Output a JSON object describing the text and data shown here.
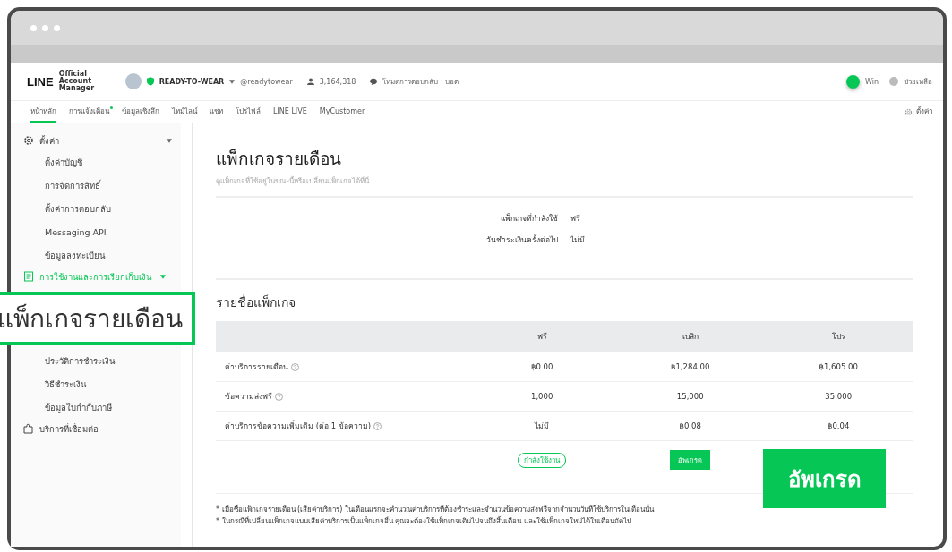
{
  "header": {
    "logo": "LINE",
    "logo_sub": "Official Account Manager",
    "account_name": "READY-TO-WEAR",
    "account_id": "@readytowear",
    "friends": "3,164,318",
    "reply_mode": "โหมดการตอบกลับ : บอต",
    "user": "Win",
    "help": "ช่วยเหลือ"
  },
  "nav": {
    "items": [
      {
        "label": "หน้าหลัก",
        "selected": true,
        "badge": false
      },
      {
        "label": "การแจ้งเตือน",
        "selected": false,
        "badge": true
      },
      {
        "label": "ข้อมูลเชิงลึก",
        "selected": false,
        "badge": false
      },
      {
        "label": "ไทม์ไลน์",
        "selected": false,
        "badge": false
      },
      {
        "label": "แชท",
        "selected": false,
        "badge": false
      },
      {
        "label": "โปรไฟล์",
        "selected": false,
        "badge": false
      },
      {
        "label": "LINE LIVE",
        "selected": false,
        "badge": false
      },
      {
        "label": "MyCustomer",
        "selected": false,
        "badge": false
      }
    ],
    "settings": "ตั้งค่า"
  },
  "sidebar": {
    "items": [
      {
        "label": "ตั้งค่า",
        "kind": "gear",
        "selected": false,
        "expanded": true,
        "children": [
          {
            "label": "ตั้งค่าบัญชี"
          },
          {
            "label": "การจัดการสิทธิ์"
          },
          {
            "label": "ตั้งค่าการตอบกลับ"
          },
          {
            "label": "Messaging API"
          },
          {
            "label": "ข้อมูลลงทะเบียน"
          }
        ]
      },
      {
        "label": "การใช้งานและการเรียกเก็บเงิน",
        "kind": "receipt",
        "selected": true,
        "expanded": true,
        "children": [
          {
            "label": "แพ็กเกจรายเดือน",
            "kind": "callout"
          },
          {
            "label": "ประวัติการชำระเงิน"
          },
          {
            "label": "วิธีชำระเงิน"
          },
          {
            "label": "ข้อมูลใบกำกับภาษี"
          }
        ]
      },
      {
        "label": "บริการที่เชื่อมต่อ",
        "kind": "puzzle",
        "selected": false
      }
    ]
  },
  "page": {
    "title": "แพ็กเกจรายเดือน",
    "subtitle": "ดูแพ็กเกจที่ใช้อยู่ในขณะนี้หรือเปลี่ยนแพ็กเกจได้ที่นี่",
    "info": [
      {
        "label": "แพ็กเกจที่กำลังใช้",
        "value": "ฟรี"
      },
      {
        "label": "วันชำระเงินครั้งต่อไป",
        "value": "ไม่มี"
      }
    ],
    "section_title": "รายชื่อแพ็กเกจ",
    "table": {
      "columns": [
        "ฟรี",
        "เบสิก",
        "โปร"
      ],
      "rows": [
        {
          "label": "ค่าบริการรายเดือน",
          "cells": [
            "฿0.00",
            "฿1,284.00",
            "฿1,605.00"
          ]
        },
        {
          "label": "ข้อความส่งฟรี",
          "cells": [
            "1,000",
            "15,000",
            "35,000"
          ]
        },
        {
          "label": "ค่าบริการข้อความเพิ่มเติม (ต่อ 1 ข้อความ)",
          "cells": [
            "ไม่มี",
            "฿0.08",
            "฿0.04"
          ]
        }
      ],
      "actions": [
        {
          "kind": "current",
          "label": "กำลังใช้งาน"
        },
        {
          "kind": "upgrade",
          "label": "อัพเกรด"
        },
        {
          "kind": "callout",
          "label": "อัพเกรด"
        }
      ]
    },
    "notes": [
      "* เมื่อซื้อแพ็กเกจรายเดือน (เสียค่าบริการ) ในเดือนแรกจะคำนวณค่าบริการที่ต้องชำระและจำนวนข้อความส่งฟรีจากจำนวนวันที่ใช้บริการในเดือนนั้น",
      "* ในกรณีที่เปลี่ยนแพ็กเกจแบบเสียค่าบริการเป็นแพ็กเกจอื่น คุณจะต้องใช้แพ็กเกจเดิมไปจนถึงสิ้นเดือน และใช้แพ็กเกจใหม่ได้ในเดือนถัดไป"
    ]
  }
}
